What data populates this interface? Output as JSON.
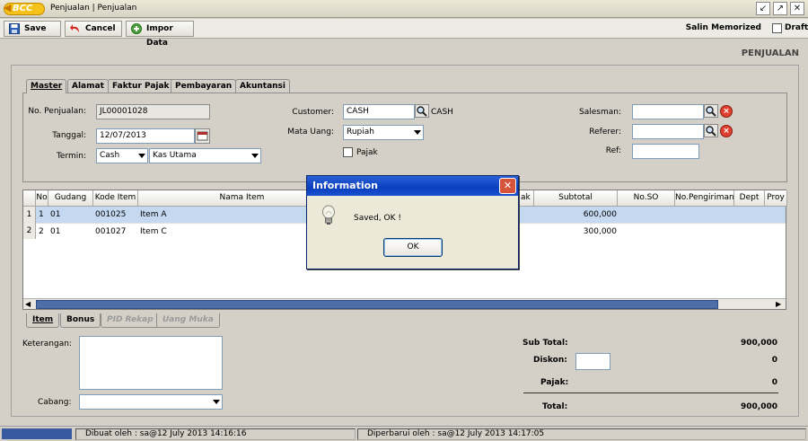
{
  "window": {
    "logo_text": "BCC",
    "title": "Penjualan | Penjualan"
  },
  "toolbar": {
    "save_label": "Save",
    "cancel_label": "Cancel",
    "import_label": "Impor Data",
    "salin_label": "Salin Memorized",
    "draft_label": "Draft"
  },
  "page_title": "PENJUALAN",
  "tabs": [
    "Master",
    "Alamat",
    "Faktur Pajak",
    "Pembayaran",
    "Akuntansi"
  ],
  "master": {
    "no_penjualan_label": "No. Penjualan:",
    "no_penjualan_value": "JL00001028",
    "tanggal_label": "Tanggal:",
    "tanggal_value": "12/07/2013",
    "termin_label": "Termin:",
    "termin_value": "Cash",
    "kas_value": "Kas Utama",
    "customer_label": "Customer:",
    "customer_value": "CASH",
    "customer_name": "CASH",
    "mata_uang_label": "Mata Uang:",
    "mata_uang_value": "Rupiah",
    "pajak_label": "Pajak",
    "salesman_label": "Salesman:",
    "salesman_value": "",
    "referer_label": "Referer:",
    "referer_value": "",
    "ref_label": "Ref:",
    "ref_value": ""
  },
  "grid": {
    "columns_left": [
      "No",
      "Gudang",
      "Kode Item",
      "Nama Item"
    ],
    "columns_right": [
      "Subtotal",
      "No.SO",
      "No.Pengiriman",
      "Dept",
      "Proy"
    ],
    "partial_col": "ak",
    "rows": [
      {
        "row": "1",
        "no": "1",
        "gudang": "01",
        "kode": "001025",
        "nama": "Item A",
        "subtotal": "600,000"
      },
      {
        "row": "2",
        "no": "2",
        "gudang": "01",
        "kode": "001027",
        "nama": "Item C",
        "subtotal": "300,000"
      }
    ]
  },
  "bottom_tabs": [
    "Item",
    "Bonus",
    "PID Rekap",
    "Uang Muka"
  ],
  "keterangan_label": "Keterangan:",
  "cabang_label": "Cabang:",
  "summary": {
    "subtotal_label": "Sub Total:",
    "subtotal_value": "900,000",
    "diskon_label": "Diskon:",
    "diskon_value": "0",
    "pajak_label": "Pajak:",
    "pajak_value": "0",
    "total_label": "Total:",
    "total_value": "900,000"
  },
  "status": {
    "dibuat": "Dibuat oleh : sa@12 July 2013  14:16:16",
    "diperbarui": "Diperbarui oleh : sa@12 July 2013  14:17:05"
  },
  "dialog": {
    "title": "Information",
    "message": "Saved, OK !",
    "ok_label": "OK",
    "close_glyph": "✕"
  },
  "colors": {
    "selected_row": "#c4d8ef",
    "dialog_title": "#0b3fbe"
  }
}
